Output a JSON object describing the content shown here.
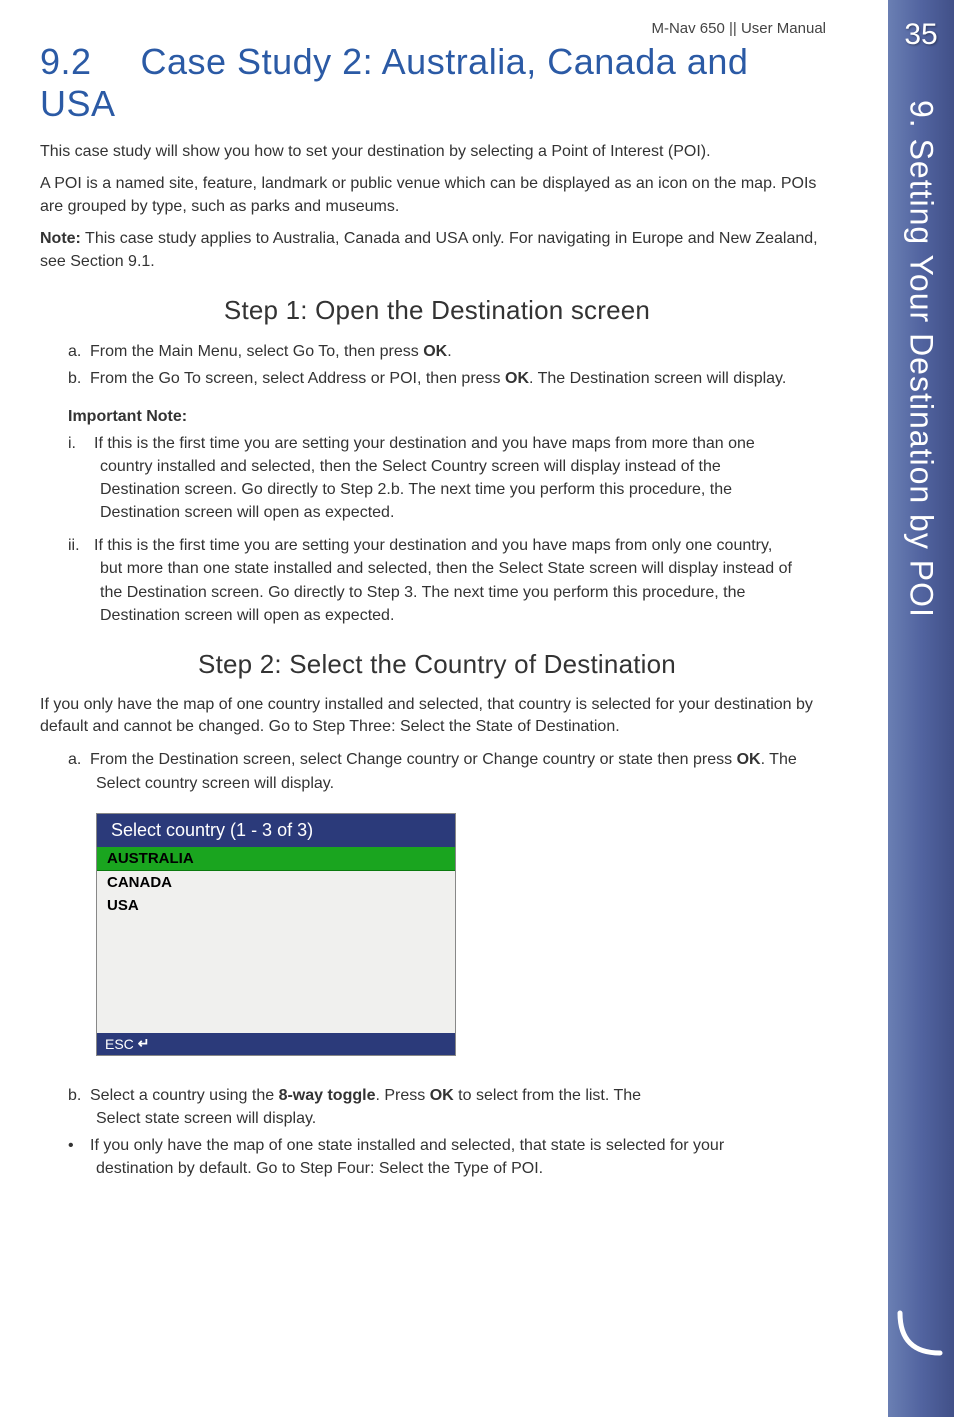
{
  "header": "M-Nav 650 || User Manual",
  "page_number": "35",
  "side_tab": "9. Setting Your Destination by POI",
  "section": {
    "number": "9.2",
    "title": "Case Study 2: Australia, Canada and USA"
  },
  "intro_p1": "This case study will show you how to set your destination by selecting a Point of Interest (POI).",
  "intro_p2": "A POI is a named site, feature, landmark or public venue which can be displayed as an icon on the map. POIs are grouped by type, such as parks and museums.",
  "note_label": "Note:",
  "note_text": " This case study applies to Australia, Canada and USA only. For navigating in Europe and New Zealand, see Section 9.1.",
  "step1": {
    "heading": "Step 1: Open the Destination screen",
    "a_marker": "a.",
    "a_pre": "From the Main Menu, select Go To, then press ",
    "a_bold": "OK",
    "a_post": ".",
    "b_marker": "b.",
    "b_pre": "From the Go To screen, select Address or POI, then press ",
    "b_bold": "OK",
    "b_post": ". The Destination screen will display.",
    "important_label": "Important Note:",
    "i_marker": "i.",
    "i_text": "If this is the first time you are setting your destination and you have maps from more than one country installed and selected, then the Select Country screen will display instead of the Destination screen. Go directly to Step 2.b. The next time you perform this procedure, the Destination screen will open as expected.",
    "ii_marker": "ii.",
    "ii_text": "If this is the first time you are setting your destination and you have maps from only one country, but more than one state installed and selected, then the Select State screen will display instead of the Destination screen. Go directly to Step 3. The next time you perform this procedure, the Destination screen will open as expected."
  },
  "step2": {
    "heading": "Step 2: Select the Country of Destination",
    "intro": "If you only have the map of one country installed and selected, that country is selected for your destination by default and cannot be changed. Go to Step Three: Select the State of Destination.",
    "a_marker": "a.",
    "a_pre": "From the Destination screen, select Change country or Change country or state then press ",
    "a_bold": "OK",
    "a_post": ". The Select country screen will display.",
    "screenshot": {
      "title": "Select country (1 - 3 of 3)",
      "rows": [
        "AUSTRALIA",
        "CANADA",
        "USA"
      ],
      "selected_index": 0,
      "footer_esc": "ESC",
      "footer_icon": "↵"
    },
    "b_marker": "b.",
    "b_pre": "Select a country using the ",
    "b_bold1": "8-way toggle",
    "b_mid": ". Press ",
    "b_bold2": "OK",
    "b_post": " to select from the list. The Select state screen will display.",
    "bullet_marker": "•",
    "bullet_text": "If you only have the map of one state installed and selected, that state is selected for your destination by default. Go to Step Four: Select the Type of POI."
  }
}
